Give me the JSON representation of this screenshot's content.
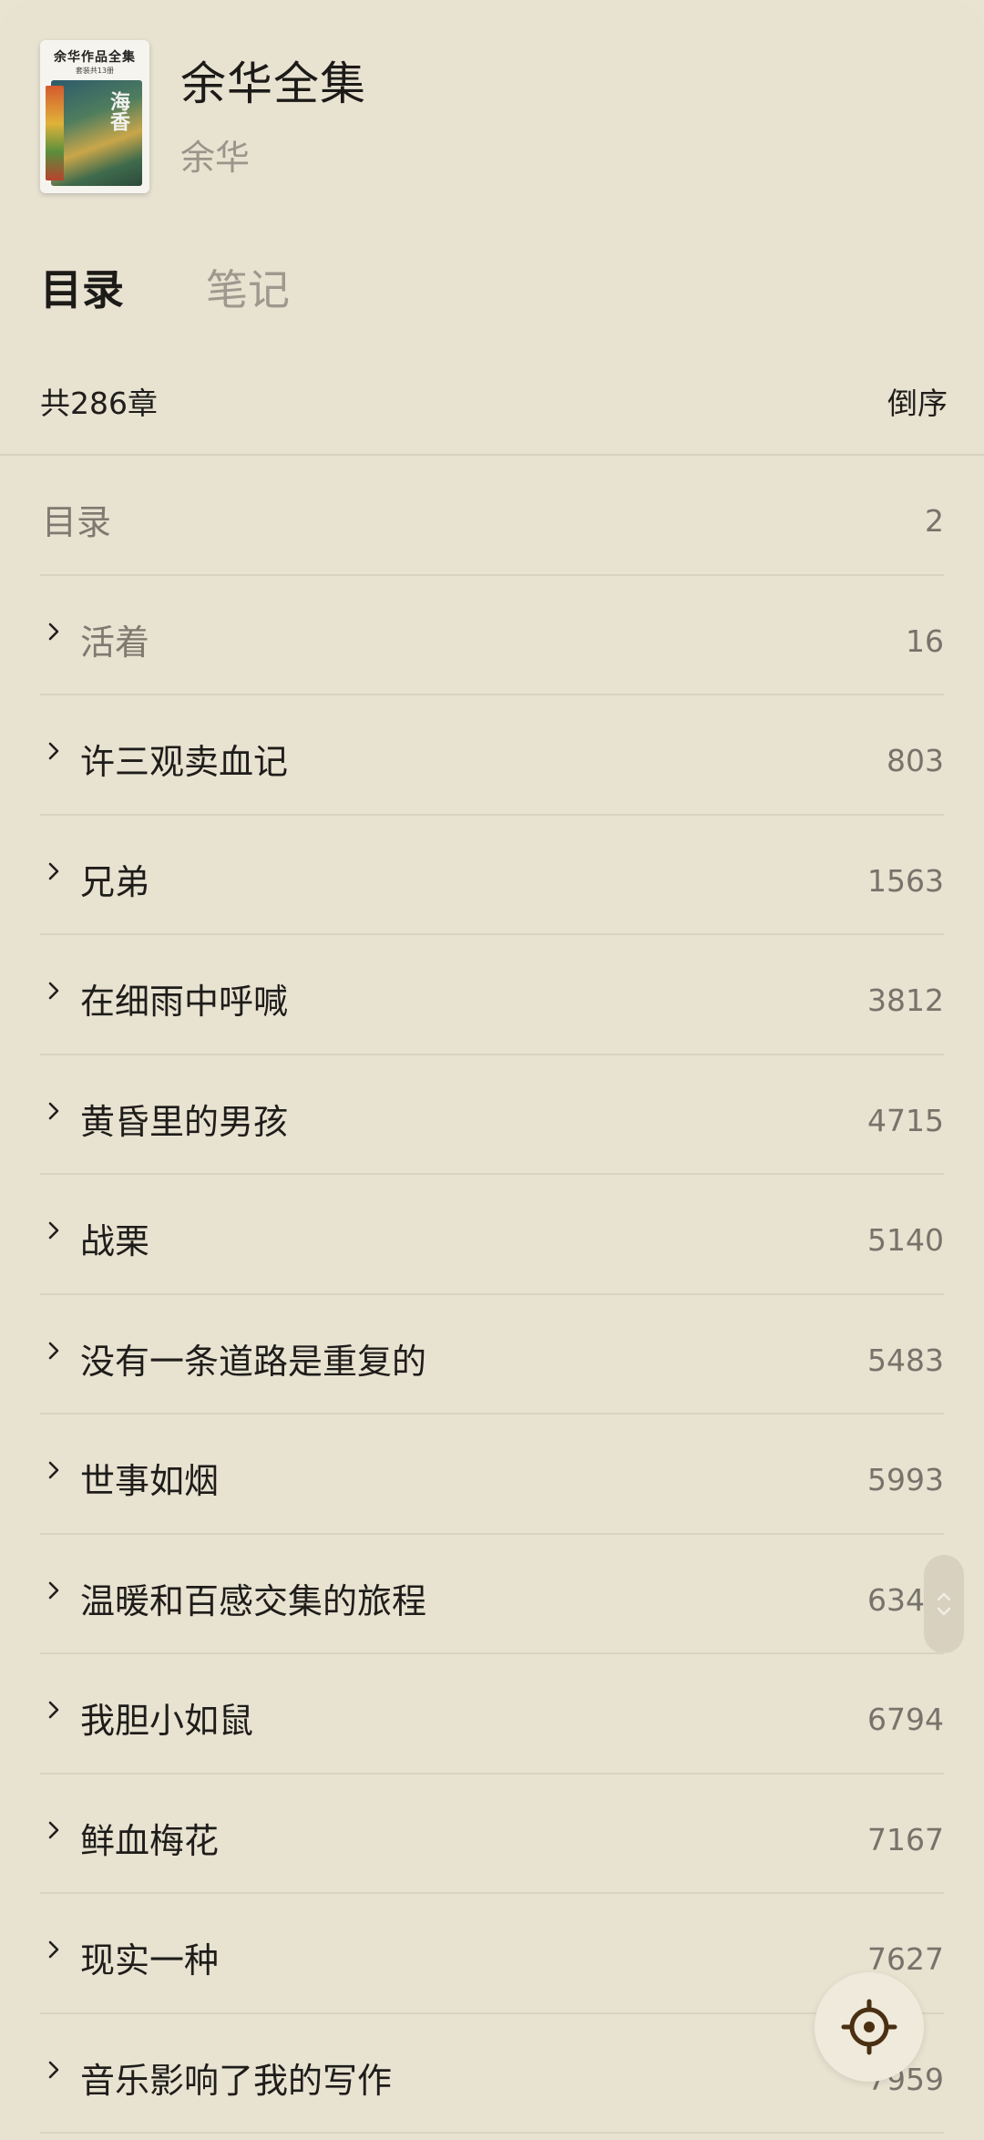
{
  "book": {
    "cover_title": "余华作品全集",
    "cover_subtitle": "套装共13册",
    "cover_glyph": "海香",
    "title": "余华全集",
    "author": "余华"
  },
  "tabs": [
    {
      "label": "目录",
      "active": true
    },
    {
      "label": "笔记",
      "active": false
    }
  ],
  "toc_header": {
    "count_label": "共286章",
    "sort_label": "倒序"
  },
  "toc": [
    {
      "label": "目录",
      "page": "2",
      "expandable": false
    },
    {
      "label": "活着",
      "page": "16",
      "expandable": true
    },
    {
      "label": "许三观卖血记",
      "page": "803",
      "expandable": true
    },
    {
      "label": "兄弟",
      "page": "1563",
      "expandable": true
    },
    {
      "label": "在细雨中呼喊",
      "page": "3812",
      "expandable": true
    },
    {
      "label": "黄昏里的男孩",
      "page": "4715",
      "expandable": true
    },
    {
      "label": "战栗",
      "page": "5140",
      "expandable": true
    },
    {
      "label": "没有一条道路是重复的",
      "page": "5483",
      "expandable": true
    },
    {
      "label": "世事如烟",
      "page": "5993",
      "expandable": true
    },
    {
      "label": "温暖和百感交集的旅程",
      "page": "6346",
      "expandable": true
    },
    {
      "label": "我胆小如鼠",
      "page": "6794",
      "expandable": true
    },
    {
      "label": "鲜血梅花",
      "page": "7167",
      "expandable": true
    },
    {
      "label": "现实一种",
      "page": "7627",
      "expandable": true
    },
    {
      "label": "音乐影响了我的写作",
      "page": "7959",
      "expandable": true
    }
  ],
  "icons": {
    "chevron": "chevron-right-icon",
    "locate": "locate-icon",
    "scroll": "scroll-handle-icon"
  },
  "colors": {
    "background": "#e8e2d1",
    "text_primary": "#1f1e1b",
    "text_muted": "#9d998e",
    "divider": "#d9d3c3",
    "locate_icon": "#4a2f12"
  }
}
